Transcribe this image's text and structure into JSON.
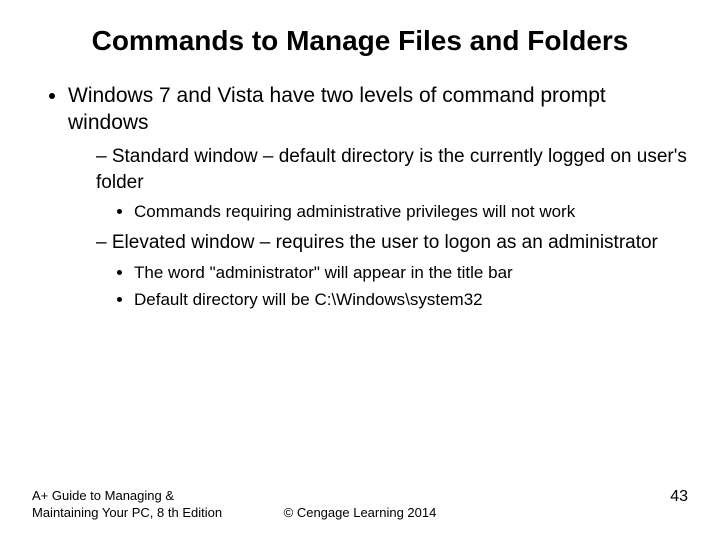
{
  "title": "Commands to Manage Files and Folders",
  "bullets": {
    "l1_0": "Windows 7 and Vista have two levels of command prompt windows",
    "l2_0": "Standard window – default directory is the currently logged on user's folder",
    "l3_0": "Commands requiring administrative privileges will not work",
    "l2_1": "Elevated window – requires the user to logon as an administrator",
    "l3_1": "The word \"administrator\" will appear in the title bar",
    "l3_2": "Default directory will be C:\\Windows\\system32"
  },
  "footer": {
    "left": "A+ Guide to Managing & Maintaining Your PC, 8 th Edition",
    "center": "© Cengage Learning  2014",
    "page": "43"
  }
}
